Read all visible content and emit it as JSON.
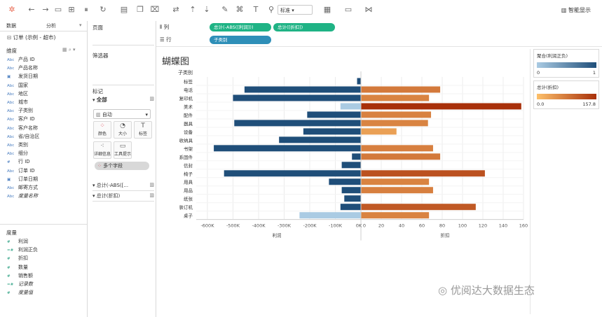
{
  "toolbar": {
    "icons": [
      "tableau-logo-icon",
      "undo-icon",
      "redo-icon",
      "save-icon",
      "new-datasource-icon",
      "pause-icon",
      "refresh-icon",
      "new-sheet-icon",
      "duplicate-sheet-icon",
      "clear-sheet-icon",
      "swap-icon",
      "sort-asc-icon",
      "sort-desc-icon",
      "highlight-icon",
      "group-icon",
      "label-icon",
      "pin-icon",
      "fit-icon",
      "presentation-icon",
      "share-icon"
    ],
    "fit_select": "标准",
    "smart_show": "智能显示"
  },
  "left_panel": {
    "tabs": [
      "数据",
      "分析"
    ],
    "datasource": "订单 (示例 - 超市)",
    "dimensions_title": "维度",
    "dimensions": [
      {
        "type": "Abc",
        "name": "产品 ID"
      },
      {
        "type": "Abc",
        "name": "产品名称"
      },
      {
        "type": "date",
        "name": "发货日期"
      },
      {
        "type": "Abc",
        "name": "国家"
      },
      {
        "type": "Abc",
        "name": "地区"
      },
      {
        "type": "Abc",
        "name": "城市"
      },
      {
        "type": "Abc",
        "name": "子类别"
      },
      {
        "type": "Abc",
        "name": "客户 ID"
      },
      {
        "type": "Abc",
        "name": "客户名称"
      },
      {
        "type": "Abc",
        "name": "省/自治区"
      },
      {
        "type": "Abc",
        "name": "类别"
      },
      {
        "type": "Abc",
        "name": "细分"
      },
      {
        "type": "#",
        "name": "行 ID"
      },
      {
        "type": "Abc",
        "name": "订单 ID"
      },
      {
        "type": "date",
        "name": "订单日期"
      },
      {
        "type": "Abc",
        "name": "邮寄方式"
      },
      {
        "type": "Abc",
        "name": "度量名称"
      }
    ],
    "measures_title": "度量",
    "measures": [
      {
        "type": "#",
        "name": "利润"
      },
      {
        "type": "=#",
        "name": "利润正负"
      },
      {
        "type": "#",
        "name": "折扣"
      },
      {
        "type": "#",
        "name": "数量"
      },
      {
        "type": "#",
        "name": "销售额"
      },
      {
        "type": "=#",
        "name": "记录数"
      },
      {
        "type": "#",
        "name": "度量值"
      }
    ]
  },
  "mid_panel": {
    "pages_title": "页面",
    "filters_title": "筛选器",
    "marks_title": "标记",
    "all_label": "全部",
    "mark_type": "自动",
    "mark_buttons": [
      "颜色",
      "大小",
      "标签",
      "详细信息",
      "工具提示"
    ],
    "multi_field_pill": "多个字段",
    "sections": [
      "总计(-ABS([...",
      "总计(折扣)"
    ]
  },
  "shelves": {
    "columns_label": "列",
    "rows_label": "行",
    "columns_pills": [
      "总计(-ABS([利润]))",
      "总计([折扣])"
    ],
    "rows_pill": "子类别"
  },
  "chart_data": {
    "type": "bar",
    "title": "蝴蝶图",
    "row_header": "子类别",
    "categories": [
      "标签",
      "电话",
      "复印机",
      "美术",
      "配件",
      "器具",
      "设备",
      "收纳具",
      "书架",
      "系固件",
      "信封",
      "椅子",
      "用具",
      "用品",
      "纸张",
      "装订机",
      "桌子"
    ],
    "series": [
      {
        "name": "利润",
        "values": [
          -15000,
          -455000,
          -500000,
          -80000,
          -210000,
          -495000,
          -225000,
          -320000,
          -575000,
          -35000,
          -75000,
          -535000,
          -125000,
          -75000,
          -65000,
          -80000,
          -240000
        ]
      },
      {
        "name": "折扣",
        "values": [
          0,
          78,
          67,
          157.8,
          69,
          66,
          35,
          0,
          71,
          78,
          0,
          122,
          67,
          71,
          0,
          113,
          67
        ]
      }
    ],
    "profit_axis": {
      "label": "利润",
      "ticks": [
        "-600K",
        "-500K",
        "-400K",
        "-300K",
        "-200K",
        "-100K",
        "0K"
      ],
      "range": [
        -630000,
        0
      ]
    },
    "discount_axis": {
      "label": "折扣",
      "ticks": [
        "0",
        "20",
        "40",
        "60",
        "80",
        "100",
        "120",
        "140",
        "160"
      ],
      "range": [
        0,
        160
      ]
    },
    "grid": true
  },
  "legends": {
    "profit_title": "聚合(利润正负)",
    "profit_min": "0",
    "profit_max": "1",
    "profit_colors": [
      "#aacbe3",
      "#1f4e79"
    ],
    "discount_title": "总计(折扣)",
    "discount_min": "0.0",
    "discount_max": "157.8",
    "discount_colors": [
      "#fdc06a",
      "#a8300a"
    ]
  },
  "watermark": "优阅达大数据生态"
}
